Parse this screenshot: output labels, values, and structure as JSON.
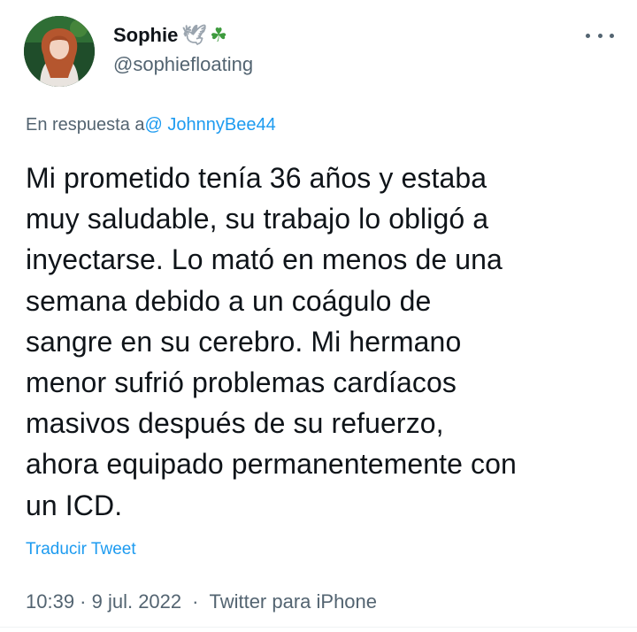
{
  "author": {
    "display_name": "Sophie",
    "emojis": [
      "🕊",
      "☘"
    ],
    "handle": "@sophiefloating"
  },
  "reply": {
    "prefix": "En respuesta a",
    "to_handle": "@ JohnnyBee44"
  },
  "tweet": {
    "lines": [
      "Mi prometido tenía 36 años y estaba",
      "muy saludable, su trabajo lo obligó a",
      "inyectarse. Lo mató en menos de una",
      "semana debido a un coágulo de",
      "sangre en su cerebro. Mi hermano",
      "menor sufrió problemas cardíacos",
      "masivos después de su refuerzo,",
      "ahora equipado permanentemente con",
      "un ICD."
    ],
    "translate_label": "Traducir Tweet",
    "time": "10:39 · 9 jul. 2022",
    "separator": "·",
    "source": "Twitter para iPhone"
  },
  "icons": {
    "more": "more-options-icon",
    "avatar": "profile-avatar"
  },
  "colors": {
    "link": "#1d9bf0",
    "secondary": "#536471",
    "text": "#0f1419"
  }
}
